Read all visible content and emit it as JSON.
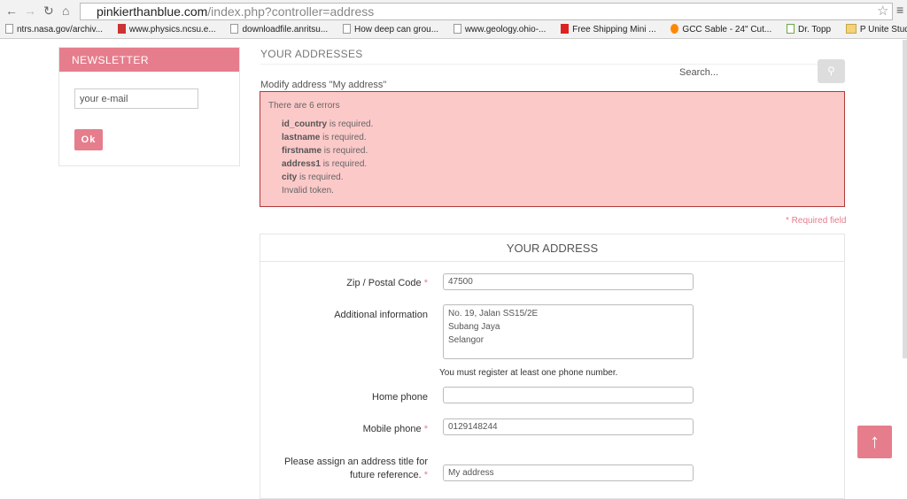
{
  "browser": {
    "url_domain": "pinkierthanblue.com",
    "url_path": "/index.php?controller=address",
    "bookmarks": [
      "ntrs.nasa.gov/archiv...",
      "www.physics.ncsu.e...",
      "downloadfile.anritsu...",
      "How deep can grou...",
      "www.geology.ohio-...",
      "Free Shipping Mini ...",
      "GCC Sable - 24\" Cut...",
      "Dr. Topp",
      "P Unite Studio"
    ]
  },
  "newsletter": {
    "title": "NEWSLETTER",
    "email_placeholder": "your e-mail",
    "ok_label": "Ok"
  },
  "header": {
    "title": "YOUR ADDRESSES",
    "search_placeholder": "Search..."
  },
  "modify_label": "Modify address \"My address\"",
  "errors": {
    "title": "There are 6 errors",
    "items": [
      {
        "field": "id_country",
        "msg": " is required."
      },
      {
        "field": "lastname",
        "msg": " is required."
      },
      {
        "field": "firstname",
        "msg": " is required."
      },
      {
        "field": "address1",
        "msg": " is required."
      },
      {
        "field": "city",
        "msg": " is required."
      },
      {
        "field": "",
        "msg": "Invalid token."
      }
    ]
  },
  "required_note": "* Required field",
  "form": {
    "title": "YOUR ADDRESS",
    "zip_label": "Zip / Postal Code",
    "zip_value": "47500",
    "additional_label": "Additional information",
    "additional_value": "No. 19, Jalan SS15/2E\nSubang Jaya\nSelangor",
    "phone_note": "You must register at least one phone number.",
    "home_phone_label": "Home phone",
    "home_phone_value": "",
    "mobile_label": "Mobile phone",
    "mobile_value": "0129148244",
    "alias_label": "Please assign an address title for future reference.",
    "alias_value": "My address",
    "star": "*"
  }
}
